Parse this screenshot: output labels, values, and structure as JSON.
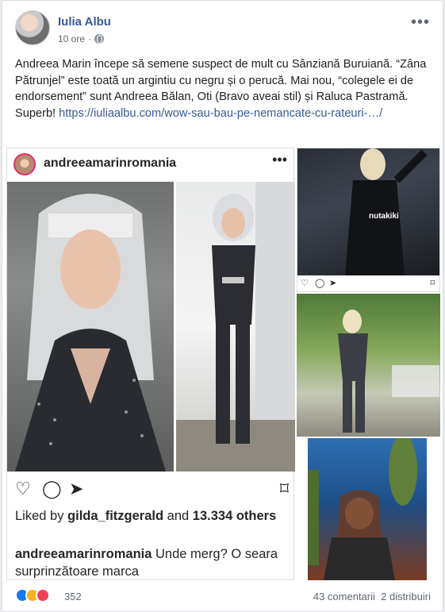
{
  "post": {
    "author": "Iulia Albu",
    "time": "10 ore",
    "privacy_icon": "globe-icon",
    "text_main": "Andreea Marin începe să semene suspect de mult cu Sânziană Buruiană. “Zâna Pătrunjel” este toată un argintiu cu negru și o perucă. Mai nou, “colegele ei de endorsement” sunt Andreea Bălan, Oti (Bravo aveai stil) și Raluca Pastramă. Superb! ",
    "link": "https://iuliaalbu.com/wow-sau-bau-pe-nemancate-cu-rateuri-…/"
  },
  "instagram": {
    "username": "andreeamarinromania",
    "liked_by_prefix": "Liked by ",
    "liked_by_user": "gilda_fitzgerald",
    "liked_and": " and ",
    "liked_count": "13.334 others",
    "caption_user": "andreeamarinromania",
    "caption_text": " Unde merg? O seara surprinzătoare marca"
  },
  "side_images": {
    "watermark": "nutakiki"
  },
  "footer": {
    "reaction_count": "352",
    "comments": "43 comentarii",
    "shares": "2 distribuiri"
  },
  "colors": {
    "link": "#385898",
    "like": "#1877f2",
    "haha": "#f7b125",
    "love": "#f33e58"
  }
}
